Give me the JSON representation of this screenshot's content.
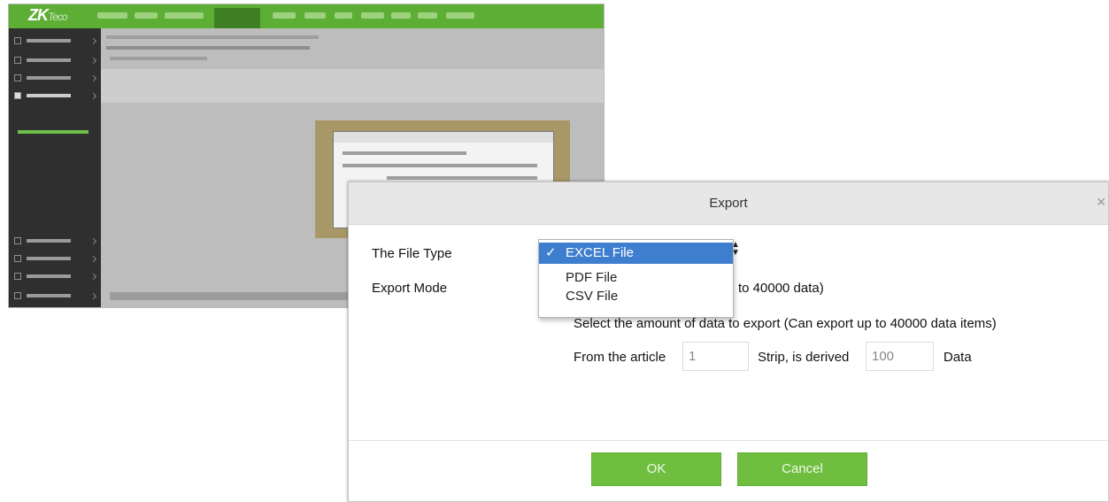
{
  "background_app": {
    "logo_text": "ZK",
    "logo_sub": "Teco"
  },
  "dialog": {
    "title": "Export",
    "file_type_label": "The File Type",
    "export_mode_label": "Export Mode",
    "file_type_options": [
      {
        "label": "EXCEL File",
        "selected": true
      },
      {
        "label": "PDF File",
        "selected": false
      },
      {
        "label": "CSV File",
        "selected": false
      }
    ],
    "selected_check": "✓",
    "mode_all_partial": "to 40000 data)",
    "mode_select_text": "Select the amount of data to export (Can export up to 40000 data items)",
    "from_label": "From the article",
    "from_value": "1",
    "strip_label": "Strip, is derived",
    "to_value": "100",
    "data_label": "Data",
    "ok_label": "OK",
    "cancel_label": "Cancel"
  },
  "colors": {
    "brand_green": "#5cae35",
    "button_green": "#6fbe40",
    "selected_option": "#3e7ecf"
  }
}
